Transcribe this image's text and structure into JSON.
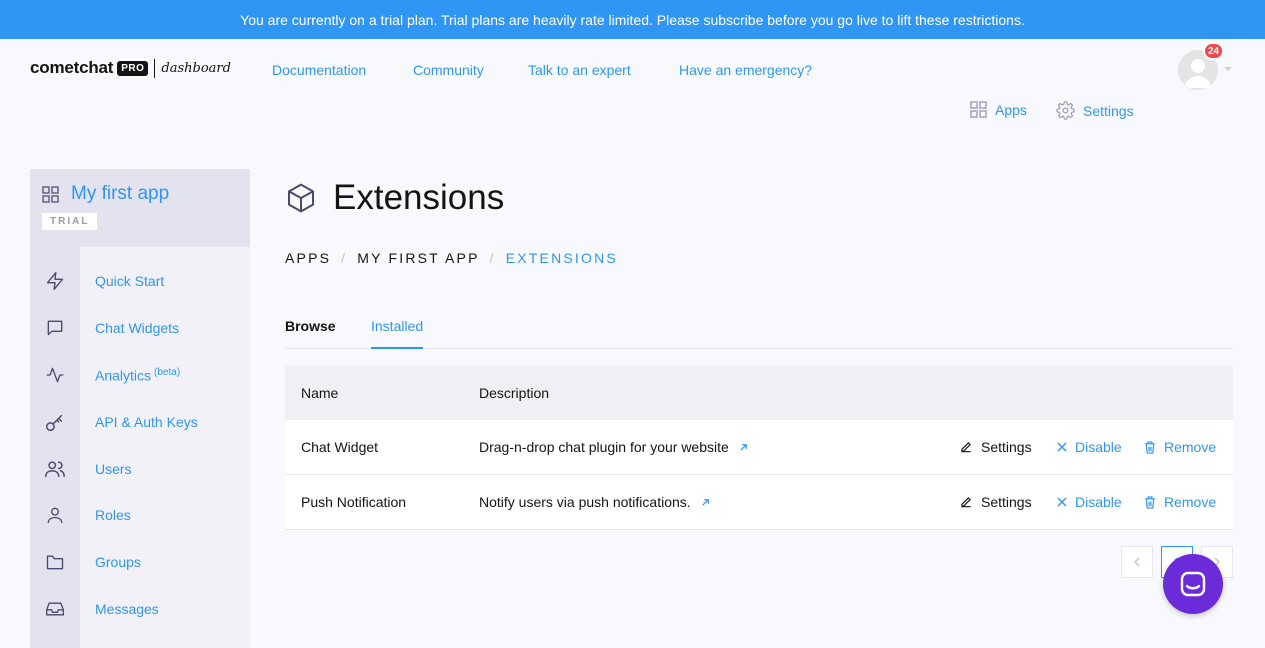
{
  "banner": {
    "text": "You are currently on a trial plan. Trial plans are heavily rate limited. Please subscribe before you go live to lift these restrictions."
  },
  "logo": {
    "brand_bold": "comet",
    "brand_rest": "chat",
    "pro": "PRO",
    "product": "dashboard"
  },
  "nav": {
    "links": [
      "Documentation",
      "Community",
      "Talk to an expert",
      "Have an emergency?"
    ],
    "apps": "Apps",
    "settings": "Settings",
    "notification_count": "24"
  },
  "sidebar": {
    "app_name": "My first app",
    "plan": "TRIAL",
    "items": [
      {
        "label": "Quick Start",
        "icon": "lightning-icon"
      },
      {
        "label": "Chat Widgets",
        "icon": "chat-bubble-icon"
      },
      {
        "label": "Analytics",
        "sup": "(beta)",
        "icon": "pulse-icon"
      },
      {
        "label": "API & Auth Keys",
        "icon": "key-icon"
      },
      {
        "label": "Users",
        "icon": "users-icon"
      },
      {
        "label": "Roles",
        "icon": "user-icon"
      },
      {
        "label": "Groups",
        "icon": "folder-icon"
      },
      {
        "label": "Messages",
        "icon": "inbox-icon"
      }
    ]
  },
  "page": {
    "title": "Extensions",
    "breadcrumb": [
      "APPS",
      "MY FIRST APP",
      "EXTENSIONS"
    ],
    "tabs": {
      "browse": "Browse",
      "installed": "Installed"
    }
  },
  "table": {
    "columns": [
      "Name",
      "Description"
    ],
    "rows": [
      {
        "name": "Chat Widget",
        "description": "Drag-n-drop chat plugin for your website"
      },
      {
        "name": "Push Notification",
        "description": "Notify users via push notifications."
      }
    ],
    "actions": {
      "settings": "Settings",
      "disable": "Disable",
      "remove": "Remove"
    }
  },
  "pagination": {
    "current_page": "1"
  },
  "colors": {
    "accent": "#2f96f3",
    "banner": "#2f96f3",
    "fab": "#6c2bd9",
    "badge": "#f1494b"
  }
}
